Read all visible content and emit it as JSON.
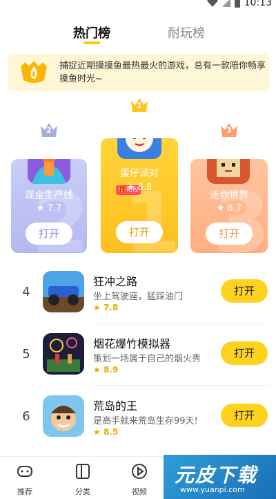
{
  "status_bar": {
    "time": "10:13"
  },
  "tabs": [
    {
      "label": "热门榜",
      "active": true
    },
    {
      "label": "耐玩榜",
      "active": false
    }
  ],
  "banner": {
    "text": "捕捉近期摸摸鱼最热最火的游戏，总有一款陪你畅享摸鱼时光~"
  },
  "podium": [
    {
      "rank": "2",
      "name": "现金生产线",
      "rating": "7.7",
      "button": "打开",
      "color": "#b4b8f0"
    },
    {
      "rank": "1",
      "name": "蛋仔派对",
      "rating": "8.8",
      "button": "打开",
      "badge": "礼包",
      "color": "#ffc21f"
    },
    {
      "rank": "3",
      "name": "迷你世界",
      "rating": "8.7",
      "button": "打开",
      "color": "#ffae80"
    }
  ],
  "list": [
    {
      "rank": "4",
      "name": "狂冲之路",
      "desc": "坐上驾驶座，猛踩油门",
      "rating": "7.8",
      "button": "打开"
    },
    {
      "rank": "5",
      "name": "烟花爆竹模拟器",
      "desc": "策划一场属于自己的烟火秀",
      "rating": "8.9",
      "button": "打开"
    },
    {
      "rank": "6",
      "name": "荒岛的王",
      "desc": "是高手就来荒岛生存99天!",
      "rating": "8.5",
      "button": "打开"
    }
  ],
  "bottom_nav": [
    {
      "label": "推荐",
      "icon": "gamepad-icon"
    },
    {
      "label": "分类",
      "icon": "category-icon"
    },
    {
      "label": "视频",
      "icon": "play-icon"
    }
  ],
  "watermark": {
    "title": "元皮下载",
    "url": "www.yuanpi.com"
  },
  "colors": {
    "accent": "#ffd21f",
    "rating": "#f0a800",
    "banner_bg": "#fff6d6"
  }
}
